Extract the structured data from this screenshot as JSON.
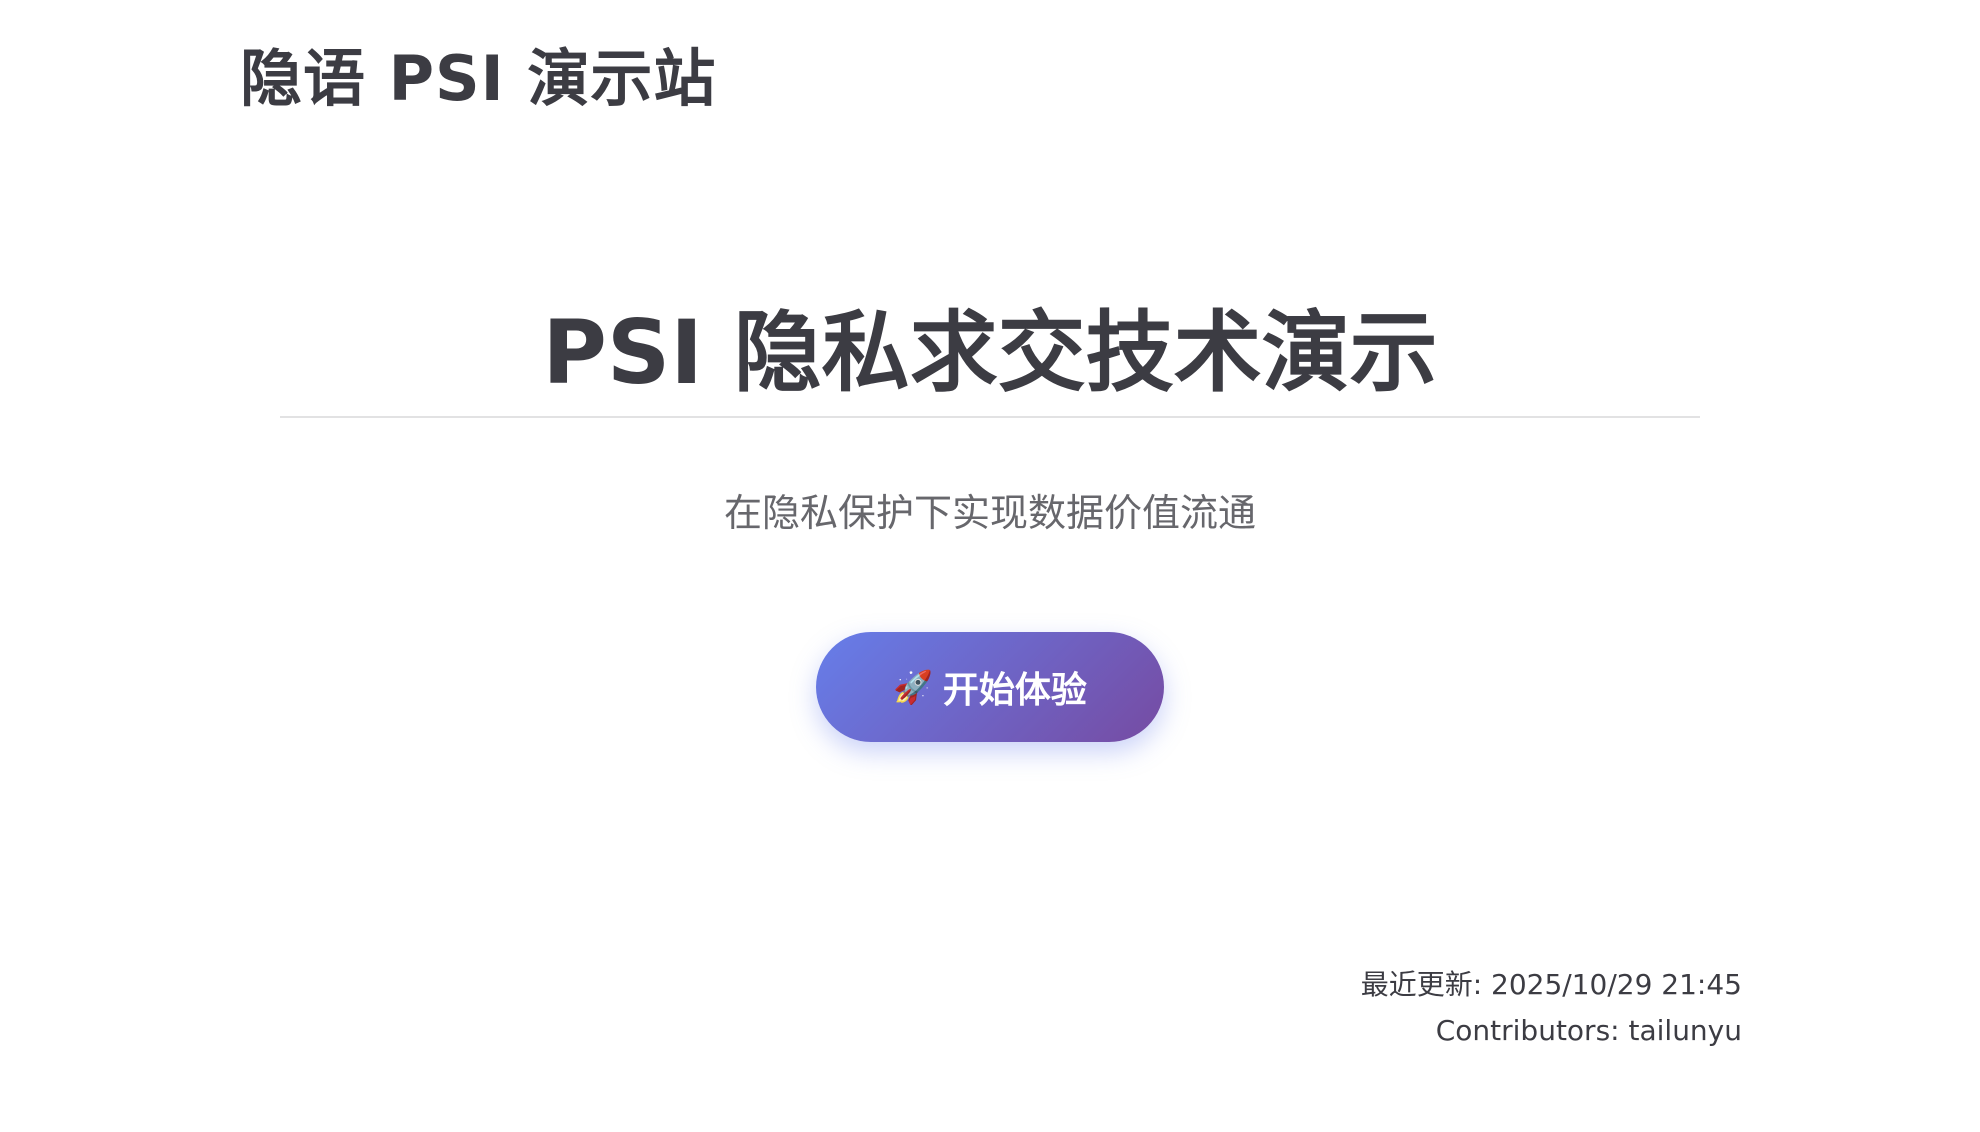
{
  "site": {
    "title": "隐语 PSI 演示站"
  },
  "hero": {
    "title": "PSI 隐私求交技术演示",
    "tagline": "在隐私保护下实现数据价值流通",
    "cta": {
      "icon": "rocket-icon",
      "icon_glyph": "🚀",
      "label": "开始体验",
      "gradient_start": "#667eea",
      "gradient_end": "#764ba2"
    }
  },
  "footer": {
    "last_updated": "最近更新: 2025/10/29 21:45",
    "contributors": "Contributors: tailunyu"
  }
}
